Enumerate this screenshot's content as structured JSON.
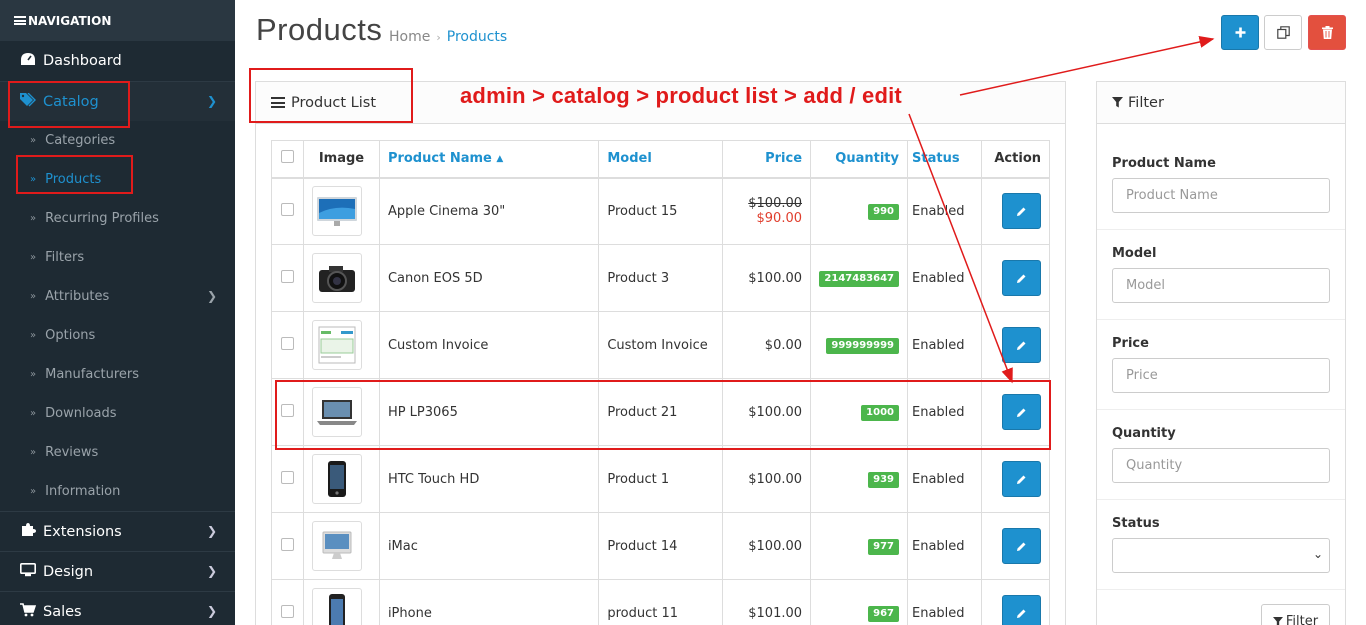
{
  "sidebar": {
    "nav_title": "NAVIGATION",
    "dashboard": "Dashboard",
    "catalog": "Catalog",
    "sub_items": [
      "Categories",
      "Products",
      "Recurring Profiles",
      "Filters",
      "Attributes",
      "Options",
      "Manufacturers",
      "Downloads",
      "Reviews",
      "Information"
    ],
    "extensions": "Extensions",
    "design": "Design",
    "sales": "Sales"
  },
  "header": {
    "title": "Products",
    "breadcrumb_home": "Home",
    "breadcrumb_current": "Products",
    "add_icon": "plus-icon",
    "copy_icon": "copy-icon",
    "delete_icon": "trash-icon"
  },
  "annotation": "admin > catalog > product list > add / edit",
  "list": {
    "panel_title": "Product List",
    "columns": {
      "image": "Image",
      "name": "Product Name",
      "model": "Model",
      "price": "Price",
      "quantity": "Quantity",
      "status": "Status",
      "action": "Action"
    },
    "rows": [
      {
        "name": "Apple Cinema 30\"",
        "model": "Product 15",
        "price": "$100.00",
        "special": "$90.00",
        "quantity": "990",
        "status": "Enabled",
        "thumb": "monitor"
      },
      {
        "name": "Canon EOS 5D",
        "model": "Product 3",
        "price": "$100.00",
        "special": "",
        "quantity": "2147483647",
        "status": "Enabled",
        "thumb": "camera"
      },
      {
        "name": "Custom Invoice",
        "model": "Custom Invoice",
        "price": "$0.00",
        "special": "",
        "quantity": "999999999",
        "status": "Enabled",
        "thumb": "invoice"
      },
      {
        "name": "HP LP3065",
        "model": "Product 21",
        "price": "$100.00",
        "special": "",
        "quantity": "1000",
        "status": "Enabled",
        "thumb": "laptop"
      },
      {
        "name": "HTC Touch HD",
        "model": "Product 1",
        "price": "$100.00",
        "special": "",
        "quantity": "939",
        "status": "Enabled",
        "thumb": "phone"
      },
      {
        "name": "iMac",
        "model": "Product 14",
        "price": "$100.00",
        "special": "",
        "quantity": "977",
        "status": "Enabled",
        "thumb": "imac"
      },
      {
        "name": "iPhone",
        "model": "product 11",
        "price": "$101.00",
        "special": "",
        "quantity": "967",
        "status": "Enabled",
        "thumb": "iphone"
      }
    ]
  },
  "filter": {
    "title": "Filter",
    "product_name_label": "Product Name",
    "product_name_placeholder": "Product Name",
    "model_label": "Model",
    "model_placeholder": "Model",
    "price_label": "Price",
    "price_placeholder": "Price",
    "quantity_label": "Quantity",
    "quantity_placeholder": "Quantity",
    "status_label": "Status",
    "status_value": "",
    "button": "Filter"
  },
  "colors": {
    "accent": "#1e91cf",
    "sidebar": "#1e2a33",
    "success": "#4cb64c",
    "danger": "#e3503e",
    "annotation": "#e01b1b"
  }
}
